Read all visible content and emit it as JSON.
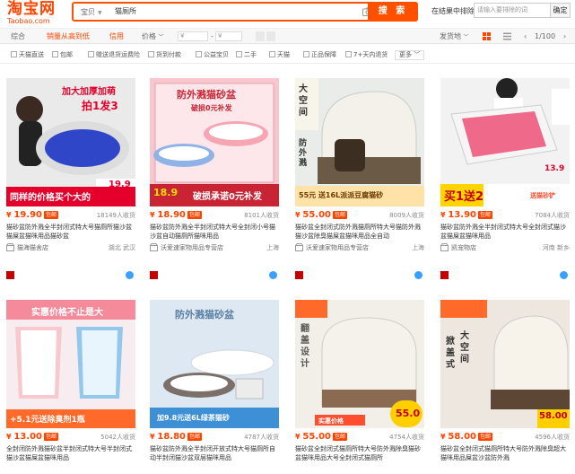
{
  "header": {
    "logo_cn": "淘宝网",
    "logo_en": "Taobao.com",
    "search_scope": "宝贝",
    "search_value": "猫厕所",
    "search_button": "搜 索",
    "exclude_label": "在结果中排除",
    "exclude_placeholder": "请输入要排除的词",
    "exclude_button": "确定"
  },
  "sortbar": {
    "default": "综合",
    "sales": "销量从高到低",
    "credit": "信用",
    "price": "价格",
    "price_from": "¥",
    "price_to": "¥",
    "ship_from": "发货地",
    "page": "1/100"
  },
  "filters": [
    "天猫直送",
    "包邮",
    "赠送退货运费险",
    "货到付款",
    "公益宝贝",
    "二手",
    "天猫",
    "正品保障",
    "7+天内退货"
  ],
  "filters_more": "更多",
  "products": [
    {
      "price": "19.90",
      "tag": "包邮",
      "sales": "18149人收货",
      "title_parts": [
        "",
        "猫",
        "砂盆防外溅全半封闭式特大号",
        "猫厕所",
        "猫",
        "沙盆猫屎盆",
        "猫",
        "咪用品猫砂盆",
        "",
        ""
      ],
      "title": "猫砂盆防外溅全半封闭式特大号猫厕所猫沙盆猫屎盆猫咪用品猫砂盆",
      "shop": "猫海猫舍店",
      "location": "湖北 武汉",
      "banner_top": "加大加厚加萌",
      "banner_mid": "拍1发3",
      "banner_bottom": "同样的价格买个大的",
      "corner_price": "19.9"
    },
    {
      "price": "18.90",
      "tag": "包邮",
      "sales": "8101人收货",
      "title": "猫砂盆防外溅全半封闭式特大号全封闭小号猫沙盆自动猫厕所猫咪用品",
      "shop": "沃爱速家物用品专营店",
      "location": "上海",
      "banner_top": "防外溅猫砂盆",
      "banner_mid": "破损0元补发",
      "banner_bottom": "破损承诺0元补发",
      "corner_price": "18.9"
    },
    {
      "price": "55.00",
      "tag": "包邮",
      "sales": "8009人收货",
      "title": "猫砂盆全封闭式防外溅猫厕所特大号猫防外溅猫沙盆除臭猫屎盆猫咪用品全自动",
      "shop": "沃爱速家物用品专营店",
      "location": "上海",
      "banner_top": "大空间",
      "banner_mid": "防外溅",
      "banner_bottom": "55元 送16L派派豆腐猫砂",
      "corner_price": ""
    },
    {
      "price": "13.90",
      "tag": "包邮",
      "sales": "7084人收货",
      "title": "猫砂盆防外溅全半封闭式特大号全封闭式猫沙盆猫屎盆猫咪用品",
      "shop": "凯宠物店",
      "location": "河南 新乡",
      "banner_top": "送猫砂铲",
      "banner_mid": "",
      "banner_bottom": "买1送2",
      "corner_price": "13.9"
    },
    {
      "price": "13.00",
      "tag": "包邮",
      "sales": "5042人收货",
      "title": "全封闭防外溅猫砂盆半封闭式特大号半封闭式猫沙盆猫屎盆猫咪用品",
      "shop": "",
      "location": "",
      "banner_top": "实惠价格不止是大",
      "banner_mid": "",
      "banner_bottom": "+5.1元送除臭剂1瓶",
      "corner_price": ""
    },
    {
      "price": "18.80",
      "tag": "包邮",
      "sales": "4787人收货",
      "title": "猫砂盆防外溅全半封闭开放式特大号猫厕所自动半封闭猫沙盆双层猫咪用品",
      "shop": "",
      "location": "",
      "banner_top": "防外溅猫砂盆",
      "banner_mid": "",
      "banner_bottom": "加9.8元送6L绿茶猫砂",
      "corner_price": ""
    },
    {
      "price": "55.00",
      "tag": "包邮",
      "sales": "4754人收货",
      "title": "猫砂盆全封闭式猫厕所特大号防外溅除臭猫砂盆猫咪用品大号全封闭式猫厕所",
      "shop": "",
      "location": "",
      "banner_top": "翻盖设计",
      "banner_mid": "实惠价格",
      "banner_bottom": "",
      "corner_price": "55.0"
    },
    {
      "price": "58.00",
      "tag": "包邮",
      "sales": "4596人收货",
      "title": "猫砂盆全封闭式猫厕所特大号防外溅除臭超大猫咪用品屎盆沙盆防外溅",
      "shop": "",
      "location": "",
      "banner_top": "掀盖式",
      "banner_mid": "大空间",
      "banner_bottom": "",
      "corner_price": "58.00"
    }
  ],
  "colors": {
    "accent": "#ff5000",
    "price": "#ff4400",
    "tmall": "#c40000"
  }
}
